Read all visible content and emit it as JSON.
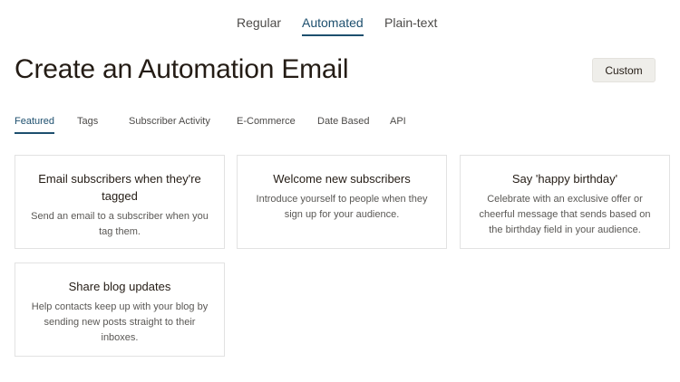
{
  "top_tabs": [
    {
      "label": "Regular",
      "active": false
    },
    {
      "label": "Automated",
      "active": true
    },
    {
      "label": "Plain-text",
      "active": false
    }
  ],
  "page": {
    "title": "Create an Automation Email",
    "custom_button": "Custom"
  },
  "category_tabs": [
    {
      "label": "Featured",
      "active": true
    },
    {
      "label": "Tags",
      "active": false
    },
    {
      "label": "Subscriber Activity",
      "active": false
    },
    {
      "label": "E-Commerce",
      "active": false
    },
    {
      "label": "Date Based",
      "active": false
    },
    {
      "label": "API",
      "active": false
    }
  ],
  "cards": [
    {
      "title": "Email subscribers when they're tagged",
      "description": "Send an email to a subscriber when you tag them."
    },
    {
      "title": "Welcome new subscribers",
      "description": "Introduce yourself to people when they sign up for your audience."
    },
    {
      "title": "Say 'happy birthday'",
      "description": "Celebrate with an exclusive offer or cheerful message that sends based on the birthday field in your audience."
    },
    {
      "title": "Share blog updates",
      "description": "Help contacts keep up with your blog by sending new posts straight to their inboxes."
    }
  ],
  "colors": {
    "accent": "#1d4f6e",
    "button_bg": "#efeeea",
    "text": "#241c15"
  }
}
